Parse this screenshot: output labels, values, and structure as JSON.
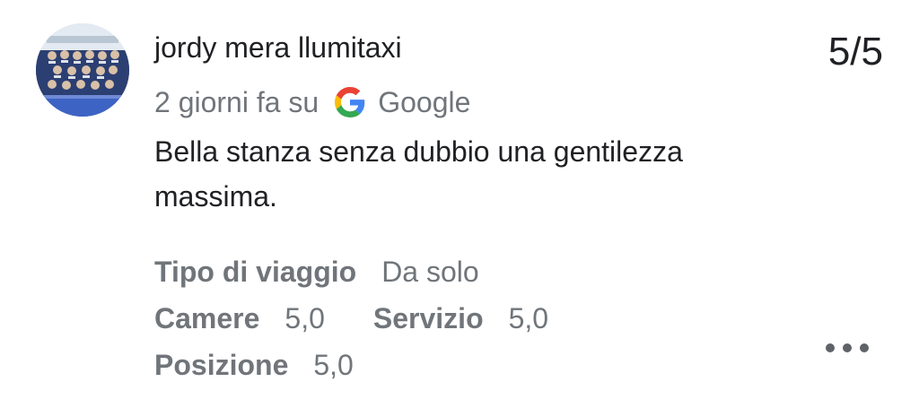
{
  "review": {
    "reviewer_name": "jordy mera llumitaxi",
    "rating": "5/5",
    "time_ago": "2 giorni fa su",
    "source": "Google",
    "text": "Bella stanza senza dubbio una gentilezza massima."
  },
  "details": {
    "trip_type_label": "Tipo di viaggio",
    "trip_type_value": "Da solo",
    "rooms_label": "Camere",
    "rooms_value": "5,0",
    "service_label": "Servizio",
    "service_value": "5,0",
    "location_label": "Posizione",
    "location_value": "5,0"
  },
  "icons": {
    "avatar": "team-photo-avatar",
    "source_icon": "google-g-icon",
    "more": "more-horizontal-icon"
  },
  "colors": {
    "text_primary": "#202124",
    "text_secondary": "#70757a",
    "google_blue": "#4285F4",
    "google_red": "#EA4335",
    "google_yellow": "#FBBC05",
    "google_green": "#34A853"
  }
}
